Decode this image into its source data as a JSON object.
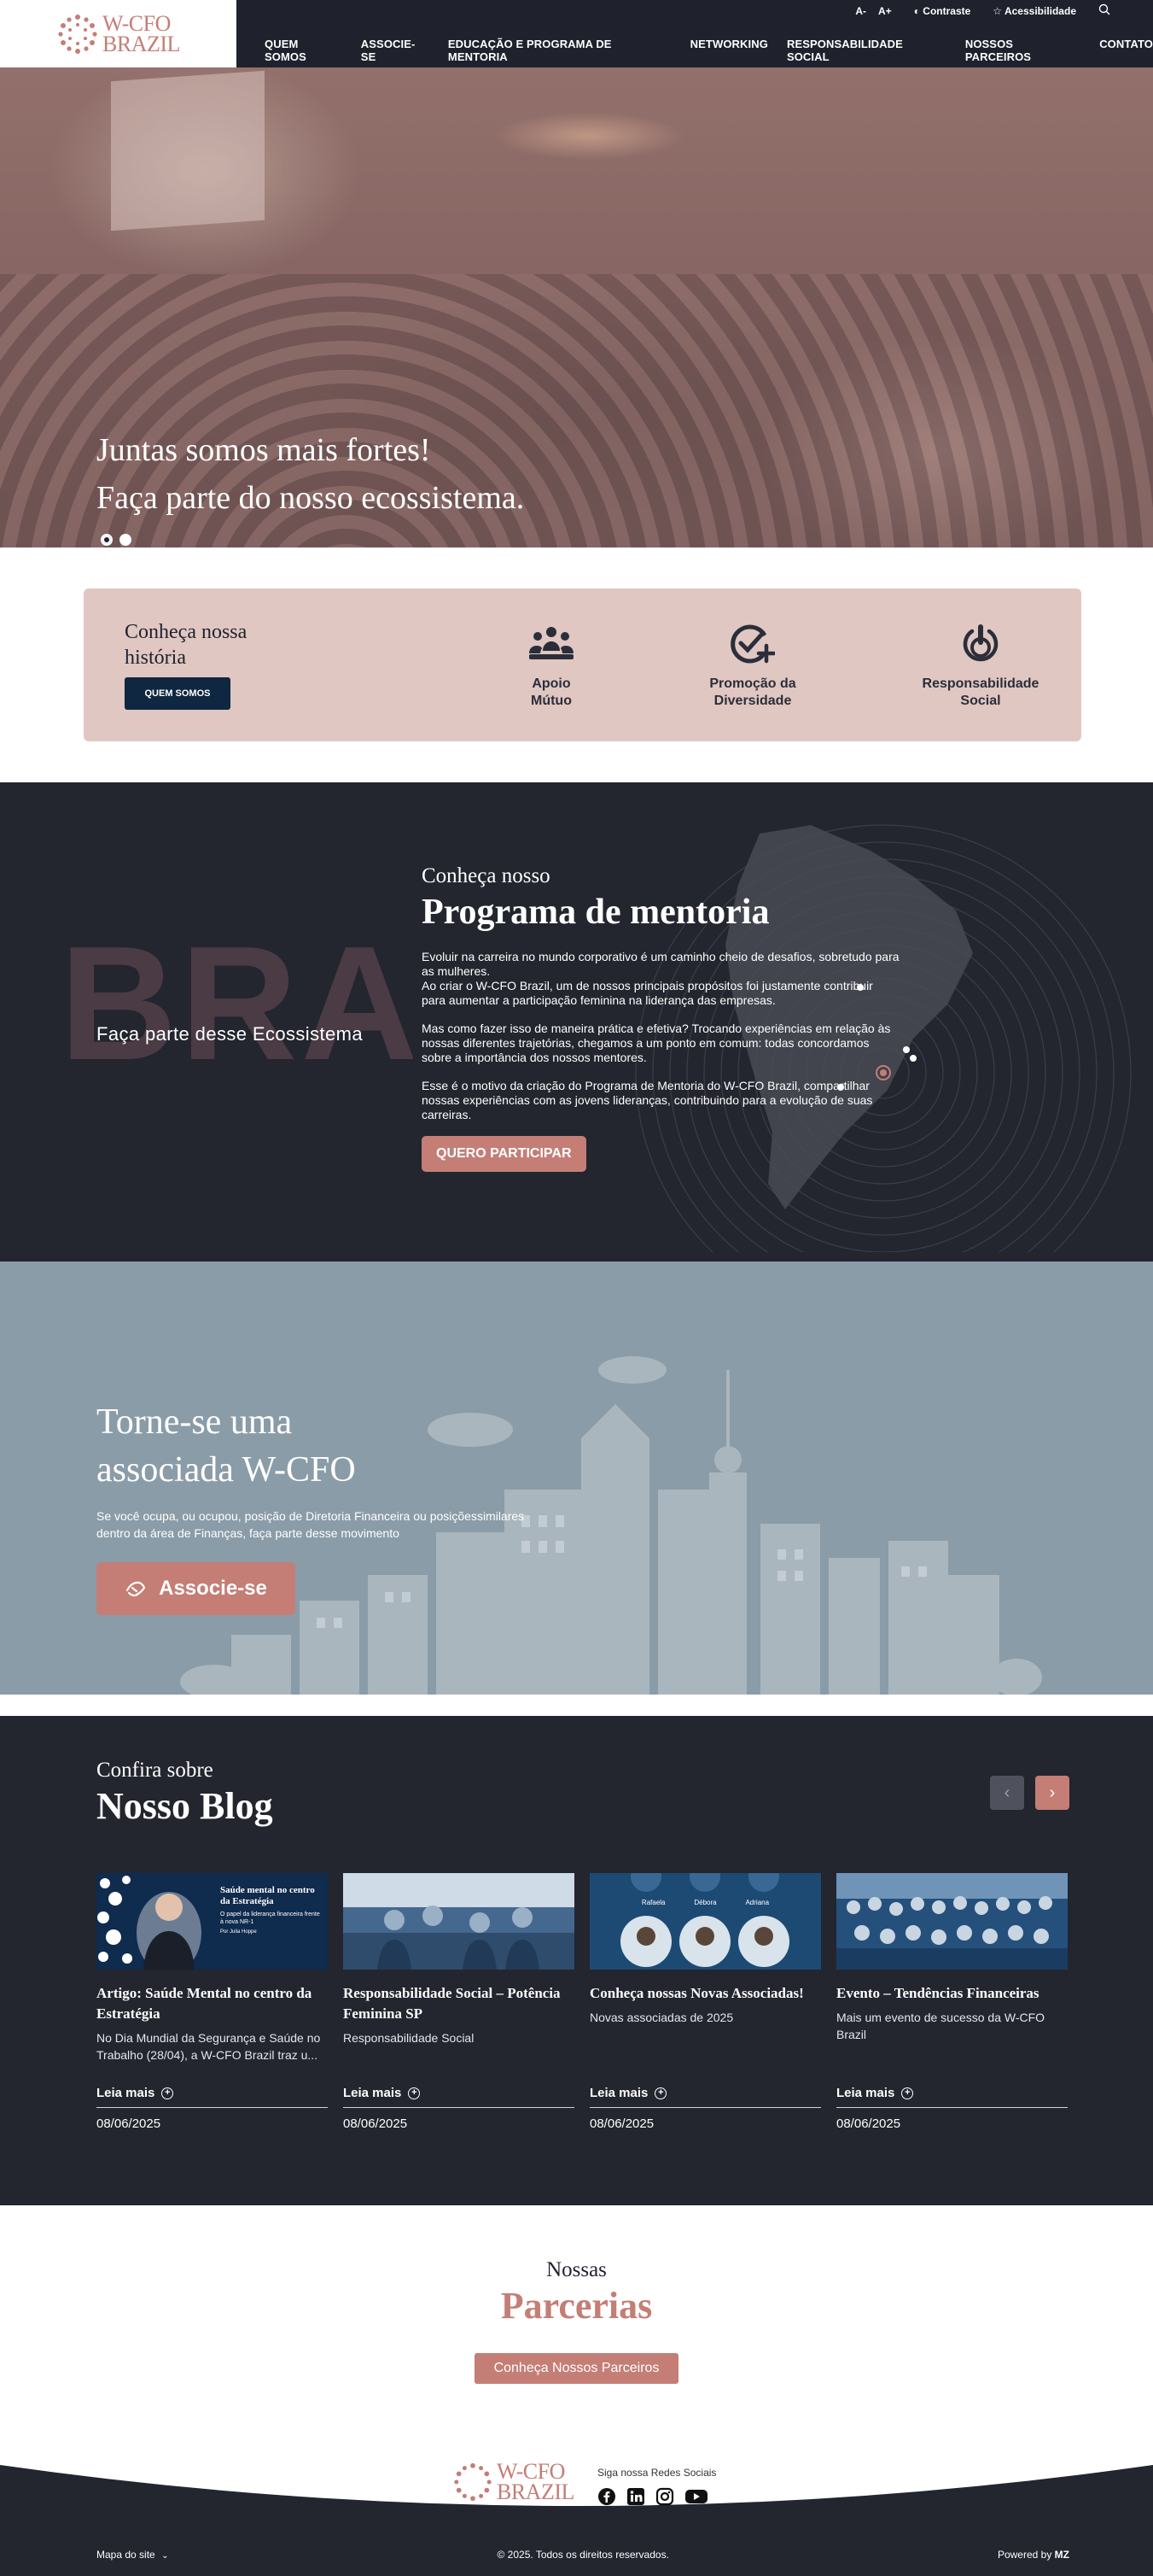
{
  "header": {
    "logo_line1": "W-CFO",
    "logo_line2": "BRAZIL",
    "util": {
      "font_minus": "A-",
      "font_plus": "A+",
      "contrast": "Contraste",
      "accessibility": "Acessibilidade"
    },
    "nav": [
      "Quem Somos",
      "Associe-se",
      "Educação e Programa de Mentoria",
      "Networking",
      "Responsabilidade Social",
      "Nossos Parceiros",
      "Contato"
    ]
  },
  "hero": {
    "line1": "Juntas somos mais fortes!",
    "line2": "Faça parte do nosso ecossistema."
  },
  "history": {
    "title": "Conheça nossa história",
    "button": "Quem Somos",
    "features": [
      {
        "icon": "people-group-icon",
        "line1": "Apoio",
        "line2": "Mútuo"
      },
      {
        "icon": "check-plus-icon",
        "line1": "Promoção da",
        "line2": "Diversidade"
      },
      {
        "icon": "power-hand-icon",
        "line1": "Responsabilidade",
        "line2": "Social"
      }
    ]
  },
  "mentoria": {
    "watermark": "BRA",
    "side_label": "Faça parte desse Ecossistema",
    "kicker": "Conheça nosso",
    "title": "Programa de mentoria",
    "p1": "Evoluir na carreira no mundo corporativo é um caminho cheio de desafios, sobretudo para as mulheres.",
    "p1b": "Ao criar o W-CFO Brazil, um de nossos principais propósitos foi justamente contribuir para aumentar a participação feminina na liderança das empresas.",
    "p2": "Mas como fazer isso de maneira prática e efetiva? Trocando experiências em relação às nossas diferentes trajetórias, chegamos a um ponto em comum: todas concordamos sobre a importância dos nossos mentores.",
    "p3": "Esse é o motivo da criação do Programa de Mentoria do W-CFO Brazil, compartilhar nossas experiências com as jovens lideranças, contribuindo para a evolução de suas carreiras.",
    "button": "Quero Participar"
  },
  "associe": {
    "line1": "Torne-se uma",
    "line2": "associada W-CFO",
    "text": "Se você ocupa, ou ocupou, posição de Diretoria Financeira ou posiçõessimilares dentro da área de Finanças, faça parte desse movimento",
    "button": "Associe-se"
  },
  "blog": {
    "kicker": "Confira sobre",
    "title": "Nosso Blog",
    "read_more": "Leia mais",
    "posts": [
      {
        "title": "Artigo: Saúde Mental no centro da Estratégia",
        "excerpt": "No Dia Mundial da Segurança e Saúde no Trabalho (28/04), a W-CFO Brazil traz u...",
        "date": "08/06/2025",
        "thumb_title": "Saúde mental no centro da Estratégia",
        "thumb_sub": "O papel da liderança financeira frente à nova NR-1",
        "thumb_author": "Por Julia Hoppe"
      },
      {
        "title": "Responsabilidade Social – Potência Feminina SP",
        "excerpt": "Responsabilidade Social",
        "date": "08/06/2025"
      },
      {
        "title": "Conheça nossas Novas Associadas!",
        "excerpt": "Novas associadas de 2025",
        "date": "08/06/2025",
        "thumb_names": [
          "Rafaela",
          "Débora",
          "Adriana"
        ]
      },
      {
        "title": "Evento – Tendências Financeiras",
        "excerpt": "Mais um evento de sucesso da W-CFO Brazil",
        "date": "08/06/2025"
      }
    ]
  },
  "parcerias": {
    "kicker": "Nossas",
    "title": "Parcerias",
    "button": "Conheça Nossos Parceiros"
  },
  "footer": {
    "follow": "Siga nossa Redes Sociais",
    "sitemap": "Mapa do site",
    "copyright": "© 2025. Todos os direitos reservados.",
    "powered": "Powered by",
    "powered_brand": "MZ",
    "social": [
      "facebook-icon",
      "linkedin-icon",
      "instagram-icon",
      "youtube-icon"
    ]
  },
  "colors": {
    "rose": "#c47e76",
    "navy": "#23252f",
    "blush": "#e0c7c2",
    "steel": "#8a9ca7"
  }
}
